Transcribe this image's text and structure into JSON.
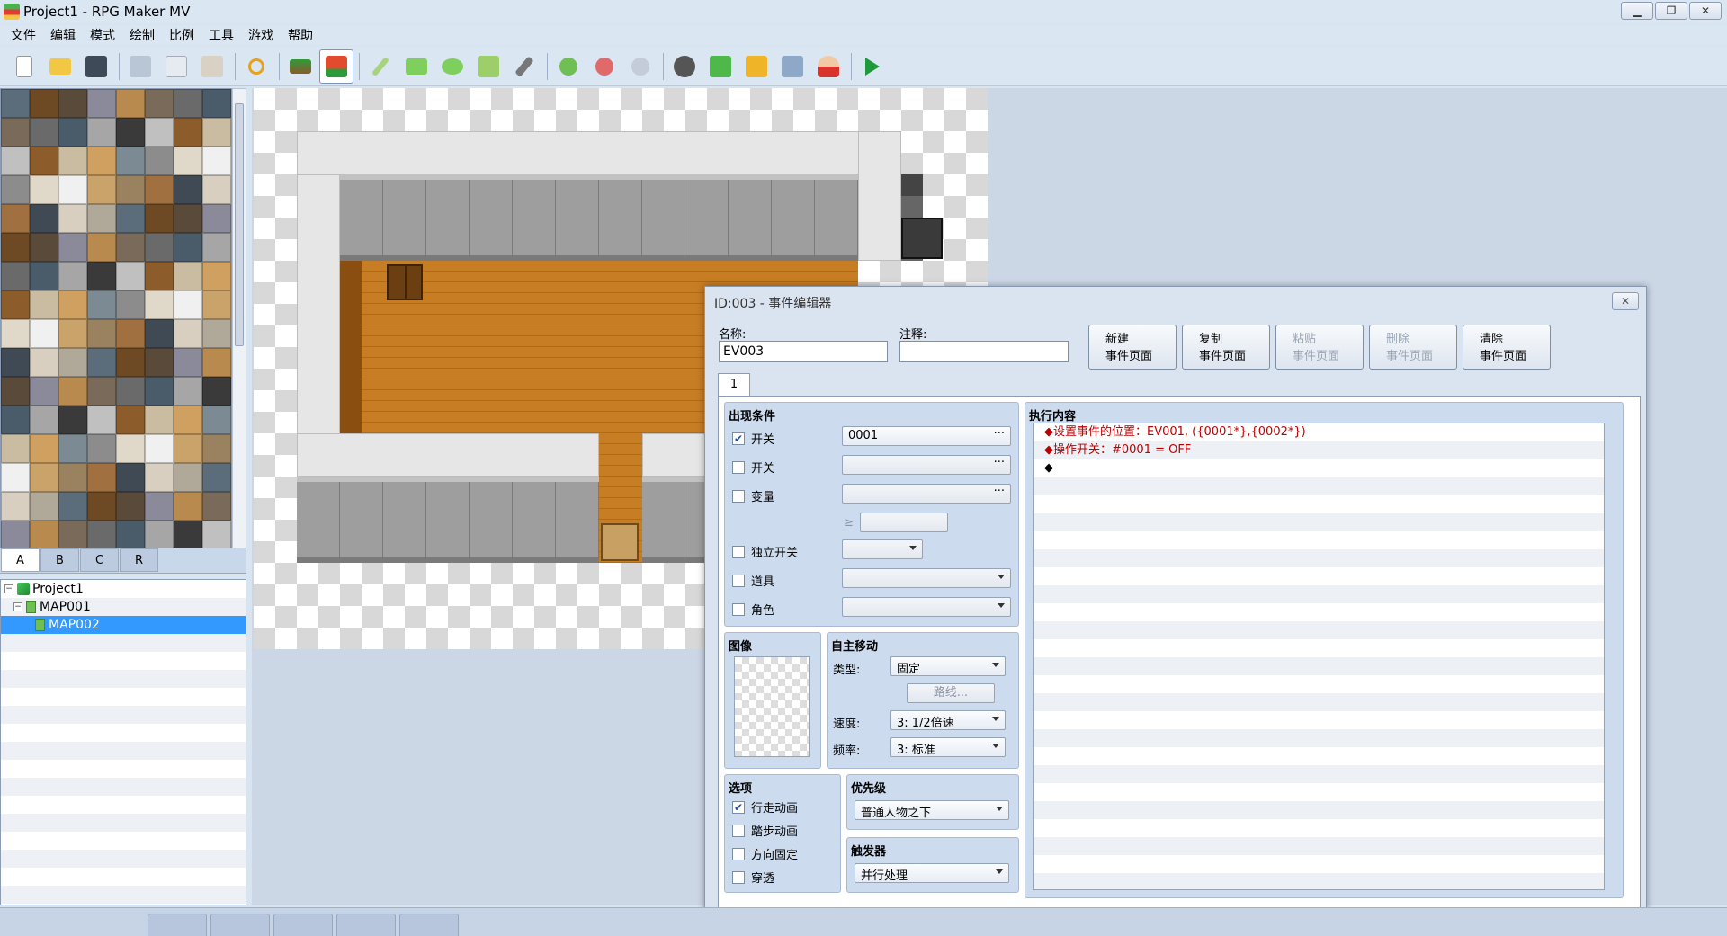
{
  "window": {
    "title": "Project1 - RPG Maker MV"
  },
  "menu": [
    "文件",
    "编辑",
    "模式",
    "绘制",
    "比例",
    "工具",
    "游戏",
    "帮助"
  ],
  "toolbar": {
    "buttons": [
      "new-project",
      "open-project",
      "save-project",
      "cut",
      "copy",
      "paste",
      "undo",
      "map-mode",
      "event-mode",
      "pencil",
      "rectangle",
      "ellipse",
      "fill",
      "shadow-pen",
      "zoom-in",
      "zoom-out",
      "zoom-actual",
      "database",
      "plugin-manager",
      "sound-test",
      "event-searcher",
      "character-generator",
      "playtest"
    ],
    "active": "event-mode",
    "icons": [
      "document-icon",
      "folder-icon",
      "save-icon",
      "scissors-icon",
      "copy-icon",
      "paste-icon",
      "undo-icon",
      "map-icon",
      "event-icon",
      "pencil-icon",
      "rectangle-icon",
      "ellipse-icon",
      "fill-icon",
      "shadow-pen-icon",
      "zoom-in-icon",
      "zoom-out-icon",
      "zoom-actual-icon",
      "gear-icon",
      "puzzle-icon",
      "speaker-icon",
      "search-icon",
      "character-icon",
      "play-icon"
    ]
  },
  "tileset": {
    "tabs": [
      "A",
      "B",
      "C",
      "R"
    ],
    "active_tab": "A"
  },
  "map_tree": {
    "items": [
      {
        "label": "Project1",
        "level": 0,
        "type": "project",
        "expanded": true
      },
      {
        "label": "MAP001",
        "level": 1,
        "type": "map",
        "expanded": true
      },
      {
        "label": "MAP002",
        "level": 2,
        "type": "map",
        "selected": true
      }
    ]
  },
  "editor": {
    "title": "ID:003 - 事件编辑器",
    "name_label": "名称:",
    "name_value": "EV003",
    "note_label": "注释:",
    "note_value": "",
    "page_buttons": [
      {
        "line1": "新建",
        "line2": "事件页面",
        "enabled": true
      },
      {
        "line1": "复制",
        "line2": "事件页面",
        "enabled": true
      },
      {
        "line1": "粘贴",
        "line2": "事件页面",
        "enabled": false
      },
      {
        "line1": "删除",
        "line2": "事件页面",
        "enabled": false
      },
      {
        "line1": "清除",
        "line2": "事件页面",
        "enabled": true
      }
    ],
    "page_tab": "1",
    "conditions": {
      "title": "出现条件",
      "switch1": {
        "label": "开关",
        "checked": true,
        "value": "0001"
      },
      "switch2": {
        "label": "开关",
        "checked": false,
        "value": ""
      },
      "variable": {
        "label": "变量",
        "checked": false,
        "value": ""
      },
      "variable_op": "≥",
      "self_switch": {
        "label": "独立开关",
        "checked": false,
        "value": ""
      },
      "item": {
        "label": "道具",
        "checked": false,
        "value": ""
      },
      "actor": {
        "label": "角色",
        "checked": false,
        "value": ""
      }
    },
    "image": {
      "title": "图像"
    },
    "autonomous": {
      "title": "自主移动",
      "type_label": "类型:",
      "type_value": "固定",
      "route_button": "路线...",
      "speed_label": "速度:",
      "speed_value": "3: 1/2倍速",
      "freq_label": "频率:",
      "freq_value": "3: 标准"
    },
    "options": {
      "title": "选项",
      "items": [
        {
          "label": "行走动画",
          "checked": true
        },
        {
          "label": "踏步动画",
          "checked": false
        },
        {
          "label": "方向固定",
          "checked": false
        },
        {
          "label": "穿透",
          "checked": false
        }
      ]
    },
    "priority": {
      "title": "优先级",
      "value": "普通人物之下"
    },
    "trigger": {
      "title": "触发器",
      "value": "并行处理"
    },
    "contents": {
      "title": "执行内容",
      "commands": [
        {
          "text": "◆设置事件的位置：EV001, ({0001*},{0002*})",
          "color": "#c00000"
        },
        {
          "text": "◆操作开关：#0001 = OFF",
          "color": "#c00000"
        },
        {
          "text": "◆",
          "color": "#000000"
        }
      ]
    }
  }
}
